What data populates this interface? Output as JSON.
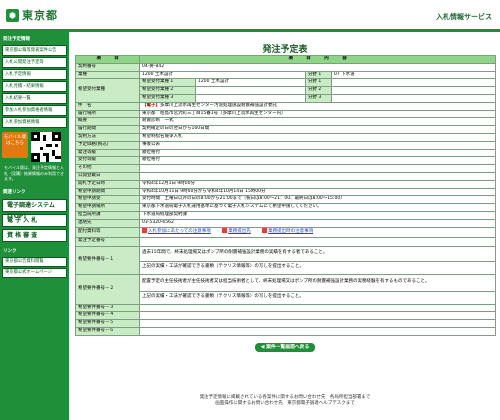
{
  "header": {
    "logo_text": "東京都",
    "logo_mark": "⬢",
    "service_title": "入札情報サービス"
  },
  "sidebar": {
    "section1": "発注予定情報",
    "items": [
      "東京都公報等発表案件公告",
      "入札公開発注予定等",
      "入札予定情報",
      "入札見積・結果情報",
      "入札結果一覧",
      "参加入札参加資格者情報",
      "入札参加資格情報"
    ],
    "mobile_btn": "モバイル版\nはこちら",
    "mobile_note": "モバイル版は、発注予定情報と入札（見積）結果情報のみ利用できます。",
    "section2": "関連リンク",
    "big1": "電子調達システム(TOP)",
    "big2": "電 子 入 札",
    "big3": "資 格 審 査",
    "section3": "リンク",
    "links": [
      "東京都公告資料閲覧",
      "東京都公式ホームページ"
    ]
  },
  "page": {
    "title": "発注予定表",
    "header_item": "項　　　目",
    "header_content": "項　　　目　　　内　　　容",
    "contract_no_label": "契約番号",
    "contract_no": "04-要-842",
    "business_label": "業種",
    "business_value": "1200 土木設計",
    "field_label": "分野 1",
    "field_value": "07 下水道",
    "hope_label": "希望受付業種",
    "hope_rows": [
      {
        "label": "希望受付業種 1",
        "value": "1200 土木設計",
        "field_label": "分野 1",
        "field_value": ""
      },
      {
        "label": "希望受付業種 2",
        "value": "",
        "field_label": "分野 2",
        "field_value": ""
      },
      {
        "label": "希望受付業種 3",
        "value": "",
        "field_label": "分野 3",
        "field_value": ""
      }
    ],
    "subject_label": "件　名",
    "subject_tag": "【電子】",
    "subject_text": "多摩川上流水再生センター汚泥処理施設耐震補強設計委託",
    "place_label": "履行場所",
    "place_value": "東京都　昭島市宮沢町三丁目15番1号（多摩川上流水再生センター内）",
    "rows": [
      {
        "label": "概要",
        "value": "耐震診断　一式"
      },
      {
        "label": "履行期間",
        "value": "契約確定の日の翌日から160日間"
      },
      {
        "label": "契約方法",
        "value": "希望制指名競争入札"
      },
      {
        "label": "予定価格(税込)",
        "value": "事後公表"
      },
      {
        "label": "発注等級",
        "value": "順位格付"
      },
      {
        "label": "受付等級",
        "value": "順位格付"
      },
      {
        "label": "その他",
        "value": ""
      },
      {
        "label": "公開登載日",
        "value": ""
      },
      {
        "label": "開札予定日時",
        "value": "令和4年12月1日 9時00分"
      },
      {
        "label": "希望申請期間",
        "value": "令和4年10月11日 9時00分から令和4年10月14日 15時00分"
      },
      {
        "label": "希望申請受",
        "value": "受付時間　土曜日以外の日の8:00から21:00まで（祝日は8:00〜21：00、最終日は8:00〜15:00）"
      },
      {
        "label": "希望申請場所",
        "value": "東京都下水道局電子入札運用基準に基づく電子入札システムにて希望申請してください。"
      },
      {
        "label": "担当局所課",
        "value": "下水道局経理部契約課"
      },
      {
        "label": "連絡先",
        "value": "03-5320-6562"
      }
    ],
    "docs_label": "配付資料等",
    "docs": [
      "入札参加にあたっての注意事項",
      "業務提出先",
      "業務提出時の注意事項"
    ],
    "req_no_label": "発注予定番号",
    "req_label_1": "希望要件番号－１",
    "req_1_line1": "過去15年間で、終末処理場又はポンプ所の耐震補強設計業務の実績を有する者であること。",
    "req_1_line2": "上記の実績・工法が確認できる書類（テクリス情報等）の写しを提出すること。",
    "req_label_2": "希望要件番号－２",
    "req_2_line1": "配置予定の主任技術者が主任技術者又は担当技術者として、終末処理場又はポンプ所の耐震補強設計業務の実務経験を有するものであること。",
    "req_2_line2": "上記の実績・工法が確認できる書類（テクリス情報等）の写しを提出すること。",
    "req_empty_labels": [
      "希望要件番号－３",
      "希望要件番号－４",
      "希望要件番号－５",
      "希望要件番号－６"
    ],
    "back_button": "◀ 案件一覧画面へ戻る"
  },
  "footer": {
    "line1": "発注予定情報に掲載されている各案件に関するお問い合わせ先　各局所担当部署まで",
    "line2": "画面操作に関するお問い合わせ先　東京都電子調達ヘルプデスクまで"
  }
}
